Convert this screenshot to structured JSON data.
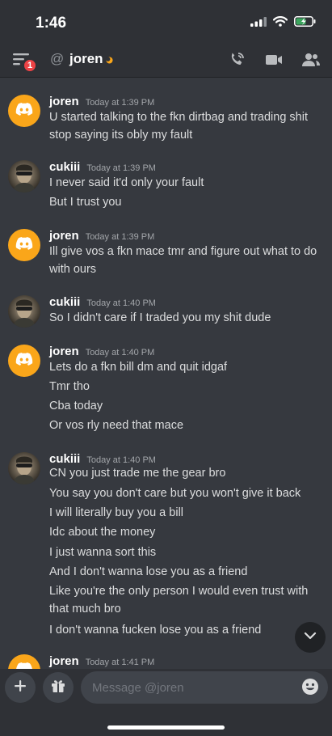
{
  "status_bar": {
    "time": "1:46"
  },
  "header": {
    "badge_count": "1",
    "at_symbol": "@",
    "channel_name": "joren"
  },
  "messages": [
    {
      "author": "joren",
      "timestamp": "Today at 1:39 PM",
      "avatar": "discord-logo",
      "lines": [
        "U started talking to the fkn dirtbag and trading shit stop saying its obly my fault"
      ]
    },
    {
      "author": "cukiii",
      "timestamp": "Today at 1:39 PM",
      "avatar": "photo",
      "lines": [
        "I never said it'd only your fault",
        "But I trust you"
      ]
    },
    {
      "author": "joren",
      "timestamp": "Today at 1:39 PM",
      "avatar": "discord-logo",
      "lines": [
        "Ill give vos a  fkn mace tmr and figure out what to do with ours"
      ]
    },
    {
      "author": "cukiii",
      "timestamp": "Today at 1:40 PM",
      "avatar": "photo",
      "lines": [
        "So I didn't care if I traded you my shit dude"
      ]
    },
    {
      "author": "joren",
      "timestamp": "Today at 1:40 PM",
      "avatar": "discord-logo",
      "lines": [
        "Lets do a fkn bill dm and quit idgaf",
        "Tmr tho",
        "Cba today",
        "Or vos rly need that mace"
      ]
    },
    {
      "author": "cukiii",
      "timestamp": "Today at 1:40 PM",
      "avatar": "photo",
      "lines": [
        "CN you just trade me the gear bro",
        "You say you don't care but you won't give it back",
        "I will literally buy you a bill",
        "Idc about the money",
        "I just wanna sort this",
        "And I don't wanna lose you as a friend",
        "Like you're the only person I would even trust with that much bro",
        "I don't wanna fucken lose you as a friend"
      ]
    },
    {
      "author": "joren",
      "timestamp": "Today at 1:41 PM",
      "avatar": "discord-logo",
      "lines": []
    }
  ],
  "composer": {
    "placeholder": "Message @joren"
  },
  "icons": {
    "menu": "hamburger-icon",
    "at": "at-icon",
    "status": "moon-icon",
    "call": "phone-call-icon",
    "video": "video-camera-icon",
    "members": "members-icon",
    "add": "plus-icon",
    "gift": "gift-icon",
    "emoji": "emoji-icon",
    "scroll": "chevron-down-icon"
  },
  "colors": {
    "background": "#36393f",
    "header": "#2f3136",
    "input": "#40444b",
    "badge": "#ed4245",
    "discord_avatar": "#faa61a",
    "idle_status": "#faa61a"
  }
}
